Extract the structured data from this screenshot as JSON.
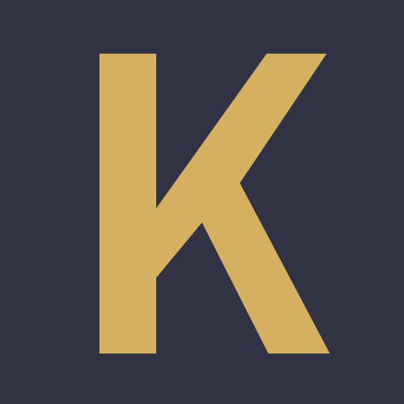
{
  "logo": {
    "letter": "K",
    "background_color": "#313244",
    "letter_color": "#D5B060"
  }
}
